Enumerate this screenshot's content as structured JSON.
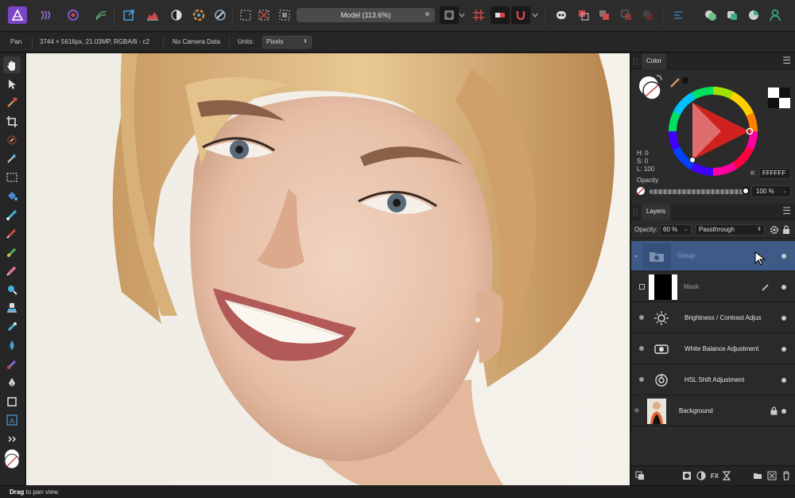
{
  "document": {
    "title": "Model (113.6%)"
  },
  "context_toolbar": {
    "tool_name": "Pan",
    "image_info": "3744 × 5616px, 21.03MP, RGBA/8 - c2",
    "camera_info": "No Camera Data",
    "units_label": "Units:",
    "units_value": "Pixels"
  },
  "color_panel": {
    "tab": "Color",
    "h": "H: 0",
    "s": "S: 0",
    "l": "L: 100",
    "hex_label": "#:",
    "hex_value": "FFFFFF",
    "opacity_label": "Opacity",
    "opacity_value": "100 %",
    "opacity_fraction": 1.0,
    "primary_color": "#ffffff",
    "secondary_color": "#000000"
  },
  "layers_panel": {
    "tab": "Layers",
    "opacity_label": "Opacity:",
    "opacity_value": "60 %",
    "blend_mode": "Passthrough",
    "layers": [
      {
        "name": "Group",
        "type": "group",
        "selected": true
      },
      {
        "name": "Mask",
        "type": "mask"
      },
      {
        "name": "Brightness / Contrast Adjus",
        "type": "adjustment",
        "icon": "sun-icon"
      },
      {
        "name": "White Balance Adjustment",
        "type": "adjustment",
        "icon": "white-balance-icon"
      },
      {
        "name": "HSL Shift Adjustment",
        "type": "adjustment",
        "icon": "hsl-icon"
      },
      {
        "name": "Background",
        "type": "pixel",
        "locked": true
      }
    ]
  },
  "status_bar": {
    "bold": "Drag",
    "text": " to pan view."
  },
  "colors": {
    "accent_selected": "#3e5a86",
    "app_icon": "#8e4fd8"
  }
}
